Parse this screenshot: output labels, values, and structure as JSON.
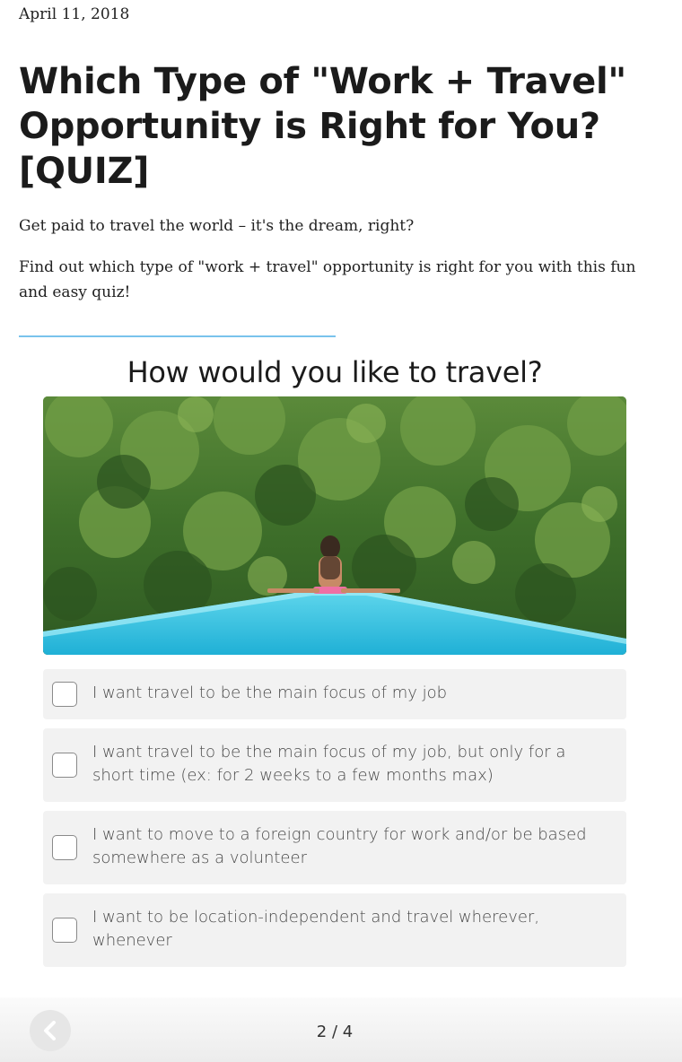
{
  "article": {
    "date": "April 11, 2018",
    "title": "Which Type of \"Work + Travel\" Opportunity is Right for You? [QUIZ]",
    "intro_1": "Get paid to travel the world – it's the dream, right?",
    "intro_2": "Find out which type of \"work + travel\" opportunity is right for you with this fun and easy quiz!"
  },
  "quiz": {
    "question": "How would you like to travel?",
    "options": [
      {
        "label": "I want travel to be the main focus of my job",
        "checked": false
      },
      {
        "label": "I want travel to be the main focus of my job, but only for a short time (ex: for 2 weeks to a few months max)",
        "checked": false
      },
      {
        "label": "I want to move to a foreign country for work and/or be based somewhere as a volunteer",
        "checked": false
      },
      {
        "label": "I want to be location-independent and travel wherever, whenever",
        "checked": false
      }
    ],
    "pager": "2 / 4",
    "back_icon": "chevron-left-icon"
  },
  "colors": {
    "rule": "#79c3ec",
    "option_bg": "#f2f2f2",
    "pool": "#3dc3e0"
  }
}
